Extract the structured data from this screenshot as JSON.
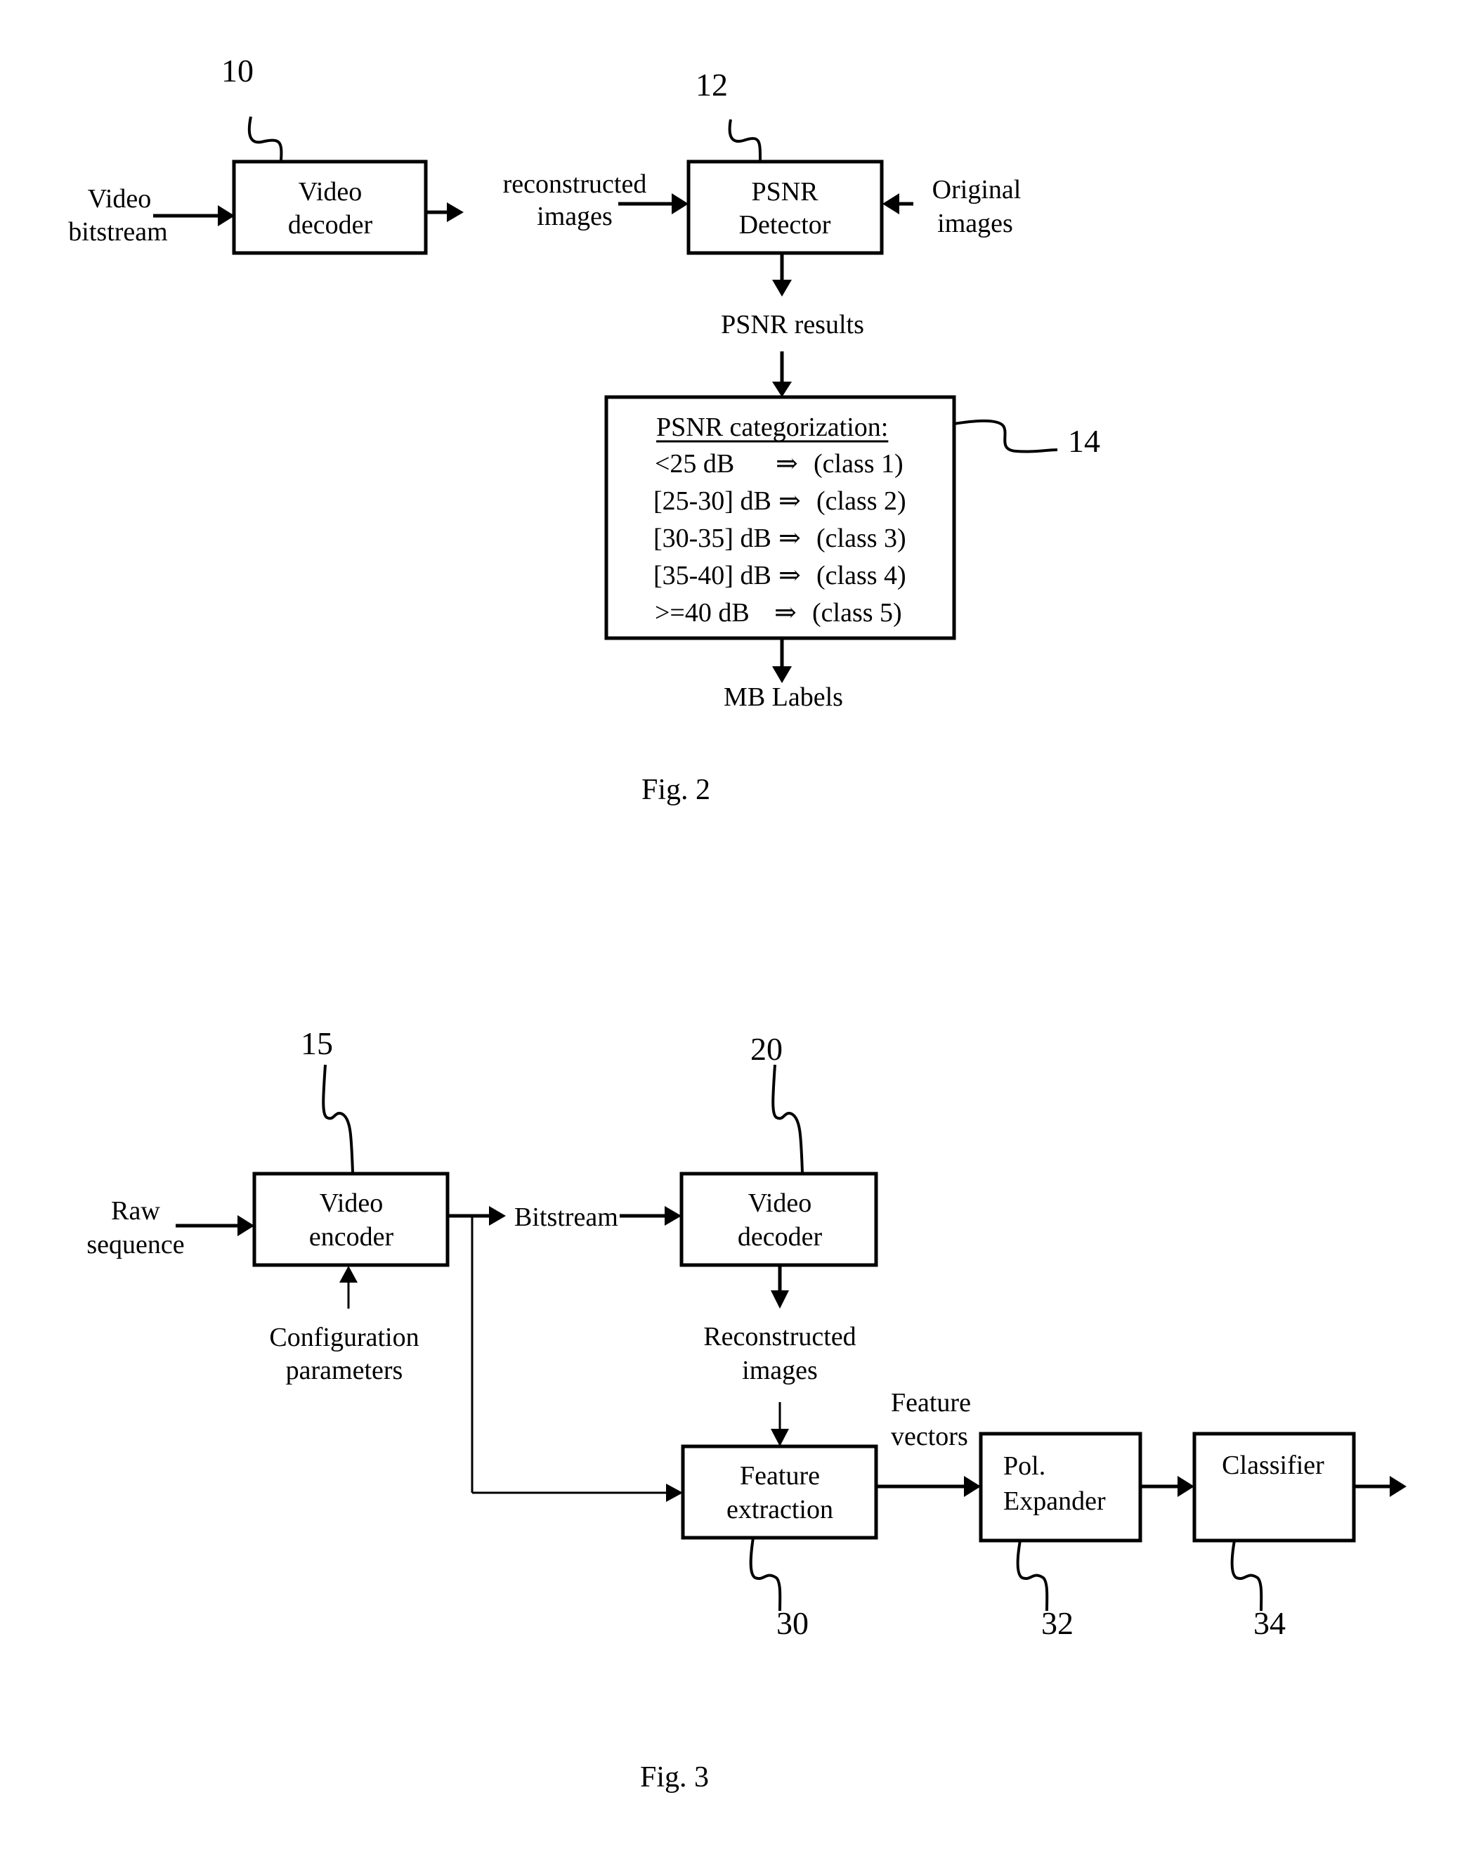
{
  "fig2": {
    "caption": "Fig. 2",
    "ref_decoder": "10",
    "ref_detector": "12",
    "ref_categorization": "14",
    "input_label_line1": "Video",
    "input_label_line2": "bitstream",
    "decoder_line1": "Video",
    "decoder_line2": "decoder",
    "recon_line1": "reconstructed",
    "recon_line2": "images",
    "detector_line1": "PSNR",
    "detector_line2": "Detector",
    "original_line1": "Original",
    "original_line2": "images",
    "psnr_results": "PSNR results",
    "categorization": {
      "title": "PSNR categorization:",
      "rows": [
        {
          "range": "<25 dB",
          "arrow": "⇒",
          "cls": "(class 1)"
        },
        {
          "range": "[25-30] dB",
          "arrow": "⇒",
          "cls": "(class 2)"
        },
        {
          "range": "[30-35] dB",
          "arrow": "⇒",
          "cls": "(class 3)"
        },
        {
          "range": "[35-40] dB",
          "arrow": "⇒",
          "cls": "(class 4)"
        },
        {
          "range": ">=40 dB",
          "arrow": "⇒",
          "cls": "(class 5)"
        }
      ]
    },
    "output_label": "MB Labels"
  },
  "fig3": {
    "caption": "Fig. 3",
    "ref_encoder": "15",
    "ref_decoder": "20",
    "ref_feature": "30",
    "ref_expander": "32",
    "ref_classifier": "34",
    "raw_line1": "Raw",
    "raw_line2": "sequence",
    "encoder_line1": "Video",
    "encoder_line2": "encoder",
    "config_line1": "Configuration",
    "config_line2": "parameters",
    "bitstream": "Bitstream",
    "decoder_line1": "Video",
    "decoder_line2": "decoder",
    "recon_line1": "Reconstructed",
    "recon_line2": "images",
    "feature_line1": "Feature",
    "feature_line2": "extraction",
    "vectors_line1": "Feature",
    "vectors_line2": "vectors",
    "expander_line1": "Pol.",
    "expander_line2": "Expander",
    "classifier": "Classifier"
  }
}
